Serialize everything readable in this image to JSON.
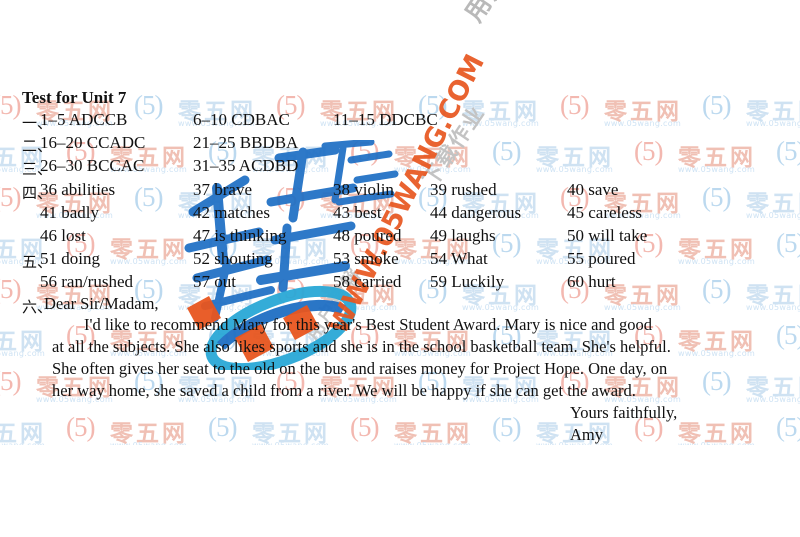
{
  "document": {
    "title": "Test for Unit 7",
    "watermark": {
      "tile_cn": "零五网",
      "tile_logo": "(5)",
      "tile_url": "www.05wang.com",
      "diagonal_url": "WWW.05WANG.COM",
      "diagonal_gray_1": "用户精解作业下载",
      "diagonal_gray_2": "下载作业",
      "diagonal_gray_3": "用户精解",
      "brush_cn": "零五网",
      "color_orange": "#e8561f",
      "color_blue": "#1f6fc4",
      "color_cyan": "#29b3d4",
      "color_tile_pink": "#f0c0b4",
      "color_tile_blue": "#cfe2f2"
    },
    "sections": [
      {
        "marker": "一、",
        "type": "grid",
        "rows": [
          [
            "1–5 ADCCB",
            "6–10 CDBAC",
            "11–15 DDCBC"
          ]
        ]
      },
      {
        "marker": "二、",
        "type": "grid",
        "rows": [
          [
            "16–20 CCADC",
            "21–25 BBDBA",
            ""
          ]
        ]
      },
      {
        "marker": "三、",
        "type": "grid",
        "rows": [
          [
            "26–30 BCCAC",
            "31–35 ACDBD",
            ""
          ]
        ]
      },
      {
        "marker": "四、",
        "type": "grid5",
        "rows": [
          [
            "36 abilities",
            "37 brave",
            "38 violin",
            "39 rushed",
            "40 save"
          ],
          [
            "41 badly",
            "42 matches",
            "43 best",
            "44 dangerous",
            "45 careless"
          ],
          [
            "46 lost",
            "47 is thinking",
            "48 poured",
            "49 laughs",
            "50 will take"
          ]
        ]
      },
      {
        "marker": "五、",
        "type": "grid5",
        "rows": [
          [
            "51 doing",
            "52 shouting",
            "53 smoke",
            "54 What",
            "55 poured"
          ],
          [
            "56 ran/rushed",
            "57 out",
            "58 carried",
            "59 Luckily",
            "60 hurt"
          ]
        ]
      },
      {
        "marker": "六、",
        "type": "letter",
        "salutation": "Dear Sir/Madam,",
        "body_lines": [
          "I'd like to recommend Mary for this year's Best Student Award. Mary is nice and good",
          "at all the subjects. She also likes sports and she is in the school basketball team. She's helpful.",
          "She often gives her seat to the old on the bus and raises money for Project Hope. One day, on",
          "her way home, she saved a child from a river. We will be happy if she can get the award."
        ],
        "closing": "Yours faithfully,",
        "signature": "Amy"
      }
    ]
  }
}
